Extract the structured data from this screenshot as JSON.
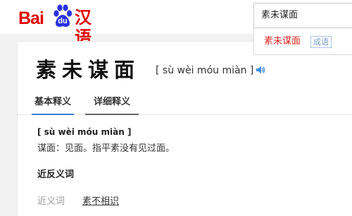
{
  "logo": {
    "prefix": "Bai",
    "badge": "du",
    "suffix": "汉语"
  },
  "search": {
    "value": "素未谋面"
  },
  "suggestion": {
    "word": "素未谋面",
    "tag": "成语"
  },
  "entry": {
    "term": "素未谋面",
    "pinyin": "[ sù wèi móu miàn ]",
    "speaker_icon": "speaker-icon"
  },
  "tabs": [
    {
      "label": "基本释义",
      "active": true
    },
    {
      "label": "详细释义",
      "active": false
    }
  ],
  "definition": {
    "pinyin": "[ sù wèi móu miàn ]",
    "text": "谋面：见面。指平素没有见过面。"
  },
  "antonyms_synonyms": {
    "title": "近反义词",
    "synonym_label": "近义词",
    "synonym_value": "素不相识"
  },
  "colors": {
    "brand_red": "#e10602",
    "logo_blue": "#2932e1",
    "suggest_red": "#e0261f",
    "tab_active": "#3a7fd6"
  }
}
